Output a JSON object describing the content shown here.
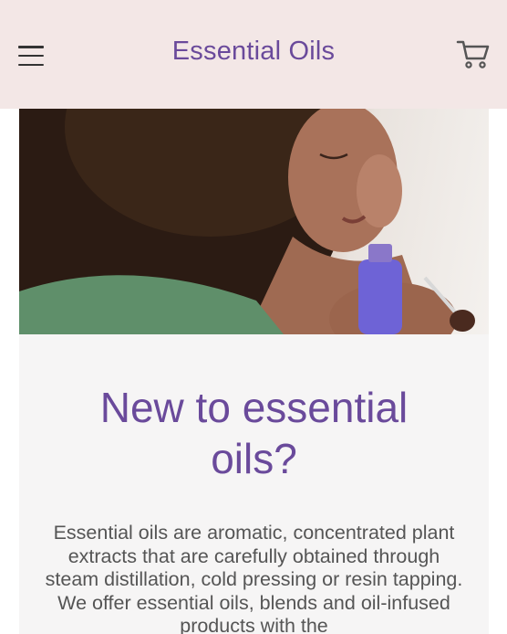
{
  "header": {
    "title": "Essential Oils",
    "menu_icon": "hamburger-menu-icon",
    "cart_icon": "shopping-cart-icon"
  },
  "hero": {
    "image": "woman-smelling-essential-oil-bottle"
  },
  "intro": {
    "title": "New to essential oils?",
    "body": "Essential oils are aromatic, concentrated plant extracts that are carefully obtained through steam distillation, cold pressing or resin tapping. We offer essential oils, blends and oil-infused products with the"
  },
  "colors": {
    "header_bg": "#f3e7e6",
    "brand": "#6a4a9b",
    "card_bg": "#f6f5f5",
    "body_text": "#555555"
  }
}
